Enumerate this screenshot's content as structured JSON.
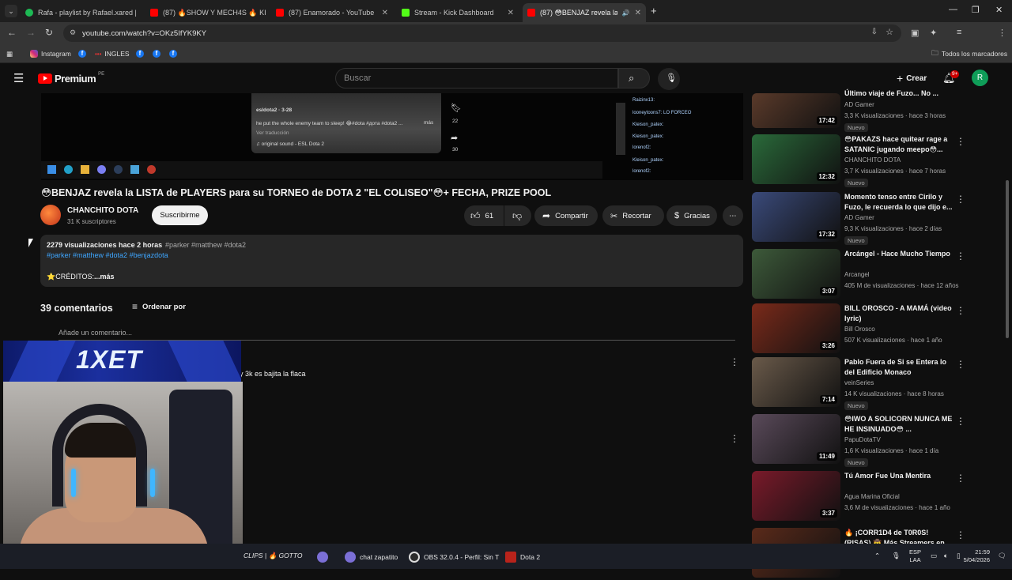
{
  "browser": {
    "tabs": [
      {
        "label": "Rafa - playlist by Rafael.xared |",
        "color": "#1db954"
      },
      {
        "label": "(87) 🔥SHOW Y MECH4S 🔥 KI",
        "color": "#ff0000"
      },
      {
        "label": "(87) Enamorado - YouTube",
        "color": "#ff0000"
      },
      {
        "label": "Stream - Kick Dashboard",
        "color": "#53fc18"
      },
      {
        "label": "(87) 😳BENJAZ revela la LIS",
        "color": "#ff0000"
      }
    ],
    "url": "youtube.com/watch?v=OKz5IfYK9KY",
    "profile_initial": "R",
    "bookmarks": [
      "Instagram",
      "INGLES"
    ],
    "all_bookmarks": "Todos los marcadores"
  },
  "yt_header": {
    "logo": "Premium",
    "region": "PE",
    "search_placeholder": "Buscar",
    "create_label": "Crear",
    "notif_badge": "9+",
    "avatar_initial": "R"
  },
  "video_frame": {
    "user": "esldota2 · 3-28",
    "caption": "he put the whole enemy team to sleep! 😂#dota #дота #dota2 ...",
    "more": "más",
    "translate": "Ver traducción",
    "sound": "♫ original sound - ESL Dota 2",
    "count1": "22",
    "count2": "30",
    "chat": [
      "Raizinx13:",
      "looneytoons7: LO FORCEO",
      "Kleison_patex:",
      "Kleison_patex:",
      "lorenof2:",
      "Kleison_patex:",
      "lorenof2:"
    ]
  },
  "video": {
    "title": "😳BENJAZ revela la LISTA de PLAYERS para su TORNEO de DOTA 2 \"EL COLISEO\"😳+ FECHA, PRIZE POOL",
    "channel": "CHANCHITO DOTA",
    "subs": "31 K suscriptores",
    "subscribe": "Suscribirme",
    "likes": "61",
    "share": "Compartir",
    "clip": "Recortar",
    "thanks": "Gracias"
  },
  "description": {
    "views_time": "2279 visualizaciones  hace 2 horas",
    "tags_inline": "#parker #matthew #dota2",
    "tags_line": "#parker #matthew #dota2 #benjazdota",
    "credits": "⭐CRÉDITOS:",
    "more": "...más"
  },
  "comments": {
    "count": "39 comentarios",
    "sort": "Ordenar por",
    "add": "Añade un comentario...",
    "first_text": "y 3k es bajita la flaca"
  },
  "overlay": {
    "banner_logo": "1XET"
  },
  "recommendations": [
    {
      "title": "Último viaje de Fuzo... No ...",
      "channel": "AD Gamer",
      "meta": "3,3 K visualizaciones · hace 3 horas",
      "new": "Nuevo",
      "duration": "17:42",
      "thumb": "#5a3a2a"
    },
    {
      "title": "😳PAKAZS hace quitear rage a SATANIC jugando meepo😳...",
      "channel": "CHANCHITO DOTA",
      "meta": "3,7 K visualizaciones · hace 7 horas",
      "new": "Nuevo",
      "duration": "12:32",
      "thumb": "#2a6a3a"
    },
    {
      "title": "Momento tenso entre Cirilo y Fuzo, le recuerda lo que dijo e...",
      "channel": "AD Gamer",
      "meta": "9,3 K visualizaciones · hace 2 días",
      "new": "Nuevo",
      "duration": "17:32",
      "thumb": "#3a4a7a"
    },
    {
      "title": "Arcángel - Hace Mucho Tiempo",
      "channel": "Arcangel",
      "meta": "405 M de visualizaciones · hace 12 años",
      "new": "",
      "duration": "3:07",
      "thumb": "#3d5a3a"
    },
    {
      "title": "BILL OROSCO - A MAMÁ (video lyric)",
      "channel": "Bill Orosco",
      "meta": "507 K visualizaciones · hace 1 año",
      "new": "",
      "duration": "3:26",
      "thumb": "#7a2a1a"
    },
    {
      "title": "Pablo Fuera de Si se Entera lo del Edificio Monaco",
      "channel": "veinSeries",
      "meta": "14 K visualizaciones · hace 8 horas",
      "new": "Nuevo",
      "duration": "7:14",
      "thumb": "#6a5a4a"
    },
    {
      "title": "😳IWO A SOLICORN NUNCA ME HE INSINUADO😳 ...",
      "channel": "PapuDotaTV",
      "meta": "1,6 K visualizaciones · hace 1 día",
      "new": "Nuevo",
      "duration": "11:49",
      "thumb": "#5a4a5a"
    },
    {
      "title": "Tú Amor Fue Una Mentira",
      "channel": "Agua Marina Oficial",
      "meta": "3,6 M de visualizaciones · hace 1 año",
      "new": "",
      "duration": "3:37",
      "thumb": "#7a1a2a"
    },
    {
      "title": "🔥 ¡CORR1D4 de T0R0S! (RISAS) 🤠 Más Streamers en...",
      "channel": "",
      "meta": "",
      "new": "",
      "duration": "",
      "thumb": "#5a2a1a"
    }
  ],
  "taskbar": {
    "items": [
      "CLIPS | 🔥 GOTTO",
      "chat zapatito",
      "OBS 32.0.4 - Perfil: Sin T",
      "Dota 2"
    ],
    "lang1": "ESP",
    "lang2": "LAA",
    "time": "21:59",
    "date": "5/04/2026"
  }
}
